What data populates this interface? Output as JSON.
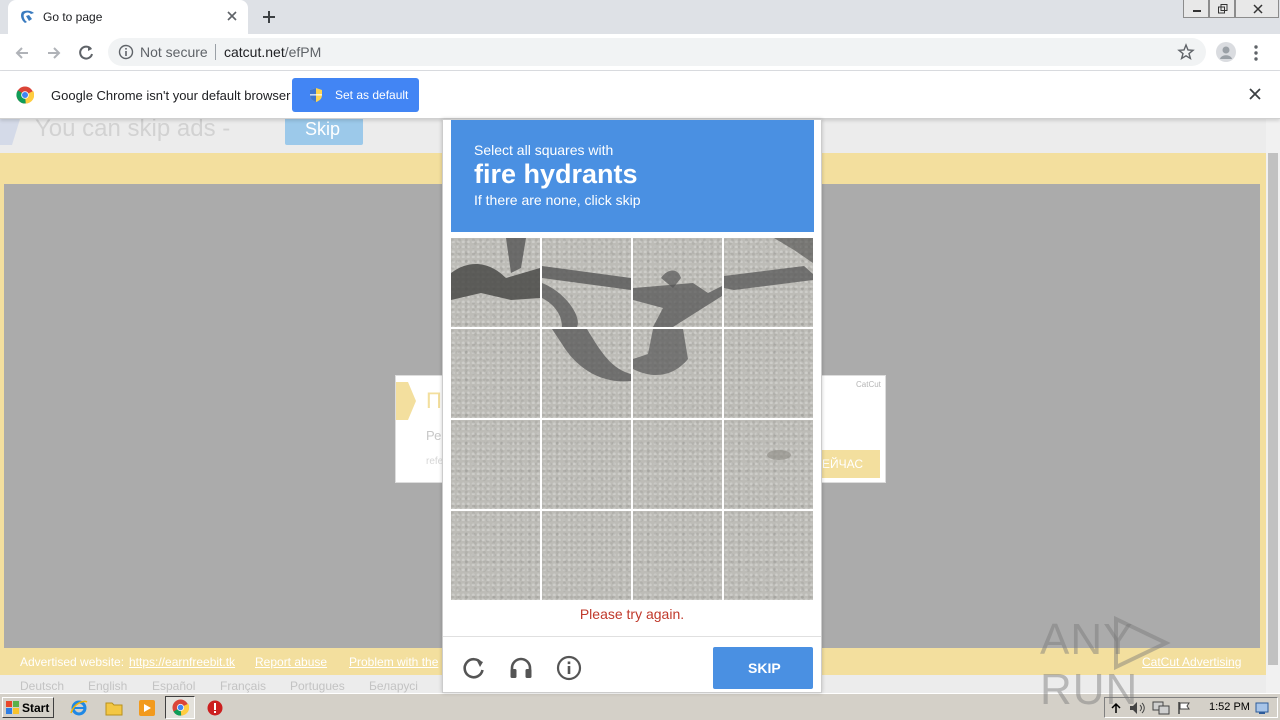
{
  "browser": {
    "tab": {
      "title": "Go to page",
      "favicon": "catcut-logo-icon"
    },
    "url": {
      "security_label": "Not secure",
      "host": "catcut.net",
      "path": "/efPM"
    }
  },
  "infobar": {
    "message": "Google Chrome isn't your default browser",
    "button_label": "Set as default"
  },
  "page": {
    "skip_text": "You can skip ads -",
    "skip_button": "Skip",
    "ad": {
      "heading": "П",
      "line1": "Ре",
      "line2": "refe",
      "cta": "ЕЙЧАС",
      "brand": "CatCut"
    },
    "footer": {
      "advertised_label": "Advertised website:",
      "advertised_link": "https://earnfreebit.tk",
      "report_abuse": "Report abuse",
      "problem": "Problem with the",
      "catcut_adv": "CatCut Advertising"
    },
    "languages": [
      "Deutsch",
      "English",
      "Español",
      "Français",
      "Portugues",
      "Беларусi"
    ]
  },
  "captcha": {
    "instruction_prefix": "Select all squares with",
    "target": "fire hydrants",
    "instruction_suffix": "If there are none, click skip",
    "error": "Please try again.",
    "skip_label": "SKIP",
    "tile_count": 16,
    "colors": {
      "header": "#4a90e2",
      "error": "#c0392b"
    }
  },
  "watermark": {
    "left": "ANY",
    "right": "RUN"
  },
  "taskbar": {
    "start_label": "Start",
    "clock": "1:52 PM"
  }
}
